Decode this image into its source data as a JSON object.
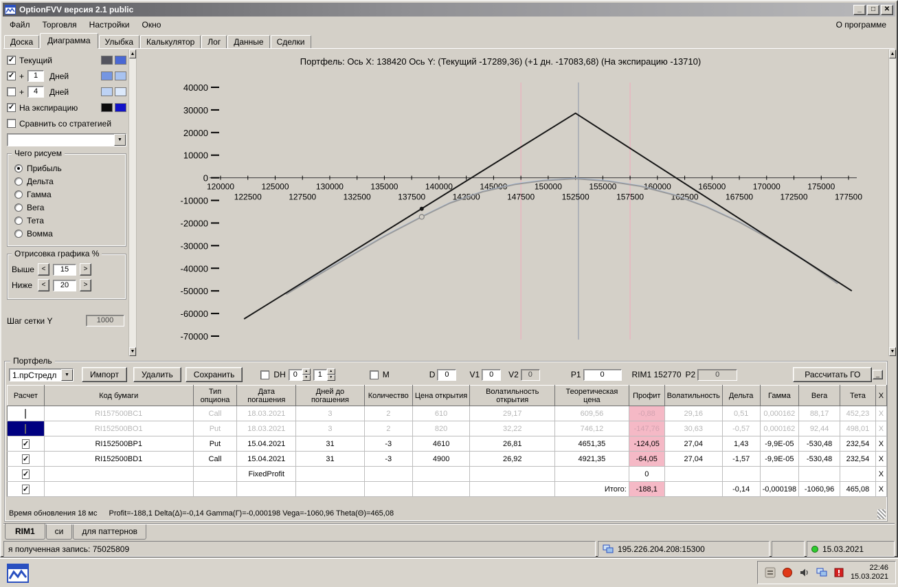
{
  "window": {
    "title": "OptionFVV версия 2.1 public",
    "buttons": {
      "minimize": "_",
      "maximize": "□",
      "close": "✕"
    }
  },
  "menu": {
    "items": [
      "Файл",
      "Торговля",
      "Настройки",
      "Окно"
    ],
    "right_item": "О программе"
  },
  "tabs": {
    "items": [
      "Доска",
      "Диаграмма",
      "Улыбка",
      "Калькулятор",
      "Лог",
      "Данные",
      "Сделки"
    ],
    "active_index": 1
  },
  "sidebar": {
    "rows": [
      {
        "label": "Текущий",
        "checked": true,
        "swatches": [
          "#54545e",
          "#4a68d4"
        ]
      },
      {
        "prefix": "+",
        "input": "1",
        "label": "Дней",
        "checked": true,
        "swatches": [
          "#7596e2",
          "#a9c3f0"
        ]
      },
      {
        "prefix": "+",
        "input": "4",
        "label": "Дней",
        "checked": false,
        "swatches": [
          "#bdd2f4",
          "#dce9fb"
        ]
      },
      {
        "label": "На экспирацию",
        "checked": true,
        "swatches": [
          "#0c0c0c",
          "#1212c8"
        ]
      },
      {
        "label": "Сравнить со стратегией",
        "checked": false,
        "swatches": []
      }
    ],
    "strategy_combo_value": "",
    "draw_group": {
      "title": "Чего рисуем",
      "options": [
        "Прибыль",
        "Дельта",
        "Гамма",
        "Вега",
        "Тета",
        "Вомма"
      ],
      "selected_index": 0
    },
    "render_group": {
      "title": "Отрисовка графика %",
      "rows": [
        {
          "label": "Выше",
          "value": "15"
        },
        {
          "label": "Ниже",
          "value": "20"
        }
      ]
    },
    "grid_step": {
      "label": "Шаг сетки Y",
      "value": "1000"
    }
  },
  "chart_data": {
    "type": "line",
    "title": "Портфель: Ось X: 138420 Ось Y: (Текущий -17289,36) (+1 дн. -17083,68) (На экспирацию -13710)",
    "xlim": [
      120000,
      177500
    ],
    "ylim": [
      -70000,
      40000
    ],
    "y_ticks": [
      40000,
      30000,
      20000,
      10000,
      0,
      -10000,
      -20000,
      -30000,
      -40000,
      -50000,
      -60000,
      -70000
    ],
    "x_ticks_row1": [
      120000,
      125000,
      130000,
      135000,
      140000,
      145000,
      150000,
      155000,
      160000,
      165000,
      170000,
      175000
    ],
    "x_ticks_row2": [
      122500,
      127500,
      132500,
      137500,
      142500,
      147500,
      152500,
      157500,
      162500,
      167500,
      172500,
      177500
    ],
    "crosshair_x": 138420,
    "vlines": [
      {
        "x": 147500,
        "color": "#f0aabb"
      },
      {
        "x": 152770,
        "color": "#8a94a8"
      },
      {
        "x": 157500,
        "color": "#f0aabb"
      }
    ],
    "series": [
      {
        "name": "plus-1-day",
        "color": "#a8c6f2",
        "width": 1.5,
        "points": [
          [
            126000,
            -51295
          ],
          [
            129000,
            -42595
          ],
          [
            132000,
            -34095
          ],
          [
            135000,
            -25695
          ],
          [
            138420,
            -17084
          ],
          [
            141000,
            -10995
          ],
          [
            144000,
            -5995
          ],
          [
            147000,
            -2695
          ],
          [
            149500,
            -1095
          ],
          [
            152500,
            -195
          ],
          [
            155500,
            -1295
          ],
          [
            158500,
            -3595
          ],
          [
            161500,
            -7395
          ],
          [
            164500,
            -12695
          ],
          [
            167500,
            -19395
          ],
          [
            170500,
            -27395
          ],
          [
            173500,
            -36495
          ],
          [
            176500,
            -46595
          ]
        ]
      },
      {
        "name": "current",
        "color": "#9a9a9a",
        "width": 2,
        "points": [
          [
            126000,
            -51500
          ],
          [
            129000,
            -42800
          ],
          [
            132000,
            -34300
          ],
          [
            135000,
            -25900
          ],
          [
            138420,
            -17289
          ],
          [
            141000,
            -11200
          ],
          [
            144000,
            -6200
          ],
          [
            147000,
            -2900
          ],
          [
            149500,
            -1300
          ],
          [
            152500,
            -400
          ],
          [
            155500,
            -1500
          ],
          [
            158500,
            -3800
          ],
          [
            161500,
            -7600
          ],
          [
            164500,
            -12900
          ],
          [
            167500,
            -19600
          ],
          [
            170500,
            -27600
          ],
          [
            173500,
            -36700
          ],
          [
            176500,
            -46800
          ]
        ]
      },
      {
        "name": "expiration",
        "color": "#161616",
        "width": 2,
        "points": [
          [
            122150,
            -62400
          ],
          [
            152500,
            28530
          ],
          [
            177800,
            -50000
          ]
        ]
      }
    ],
    "markers": [
      {
        "x": 138420,
        "y": -13710,
        "style": "dot",
        "color": "#161616"
      },
      {
        "x": 138420,
        "y": -17289,
        "style": "circle",
        "color": "#808080"
      }
    ]
  },
  "portfolio": {
    "group_label": "Портфель",
    "preset_combo": "1.прСтредл",
    "import_btn": "Импорт",
    "delete_btn": "Удалить",
    "save_btn": "Сохранить",
    "dh_label": "DH",
    "spin_a": "0",
    "spin_b": "1",
    "m_label": "M",
    "d_label": "D",
    "d_value": "0",
    "v1_label": "V1",
    "v1_value": "0",
    "v2_label": "V2",
    "v2_value": "0",
    "p1_label": "P1",
    "p1_value": "0",
    "rim_label": "RIM1 152770",
    "p2_label": "P2",
    "p2_value": "0",
    "calc_btn": "Рассчитать ГО",
    "collapse_btn": "_"
  },
  "table": {
    "headers": [
      "Расчет",
      "Код бумаги",
      "Тип опциона",
      "Дата погашения",
      "Дней до погашения",
      "Количество",
      "Цена открытия",
      "Волатильность открытия",
      "Теоретическая цена",
      "Профит",
      "Волатильность",
      "Дельта",
      "Гамма",
      "Вега",
      "Тета",
      "X"
    ],
    "rows": [
      {
        "checked": false,
        "disabled": true,
        "selected": false,
        "profit_pink": true,
        "cells": [
          "RI157500BC1",
          "Call",
          "18.03.2021",
          "3",
          "2",
          "610",
          "29,17",
          "609,56",
          "-0,88",
          "29,16",
          "0,51",
          "0,000162",
          "88,17",
          "452,23"
        ],
        "x_label": "X"
      },
      {
        "checked": false,
        "disabled": true,
        "selected": true,
        "profit_pink": true,
        "cells": [
          "RI152500BO1",
          "Put",
          "18.03.2021",
          "3",
          "2",
          "820",
          "32,22",
          "746,12",
          "-147,76",
          "30,63",
          "-0,57",
          "0,000162",
          "92,44",
          "498,01"
        ],
        "x_label": "X"
      },
      {
        "checked": true,
        "disabled": false,
        "selected": false,
        "profit_pink": true,
        "cells": [
          "RI152500BP1",
          "Put",
          "15.04.2021",
          "31",
          "-3",
          "4610",
          "26,81",
          "4651,35",
          "-124,05",
          "27,04",
          "1,43",
          "-9,9E-05",
          "-530,48",
          "232,54"
        ],
        "x_label": "X"
      },
      {
        "checked": true,
        "disabled": false,
        "selected": false,
        "profit_pink": true,
        "cells": [
          "RI152500BD1",
          "Call",
          "15.04.2021",
          "31",
          "-3",
          "4900",
          "26,92",
          "4921,35",
          "-64,05",
          "27,04",
          "-1,57",
          "-9,9E-05",
          "-530,48",
          "232,54"
        ],
        "x_label": "X"
      },
      {
        "checked": true,
        "disabled": false,
        "selected": false,
        "profit_pink": false,
        "cells": [
          "",
          "",
          "FixedProfit",
          "",
          "",
          "",
          "",
          "",
          "0",
          "",
          "",
          "",
          "",
          ""
        ],
        "x_label": "X"
      },
      {
        "checked": true,
        "disabled": false,
        "selected": false,
        "profit_pink": true,
        "cells": [
          "",
          "",
          "",
          "",
          "",
          "",
          "",
          "Итого:",
          "-188,1",
          "",
          "-0,14",
          "-0,000198",
          "-1060,96",
          "465,08"
        ],
        "x_label": "X"
      }
    ]
  },
  "status_line": {
    "left": "Время обновления 18 мс",
    "right": "Profit=-188,1 Delta(Δ)=-0,14 Gamma(Г)=-0,000198 Vega=-1060,96 Theta(Θ)=465,08"
  },
  "bottom_tabs": {
    "items": [
      "RIM1",
      "си",
      "для паттернов"
    ],
    "active_index": 0
  },
  "status_bar": {
    "record_text": "я полученная запись: 75025809",
    "ip": "195.226.204.208:15300",
    "date": "15.03.2021"
  },
  "taskbar": {
    "clock_time": "22:46",
    "clock_date": "15.03.2021"
  }
}
